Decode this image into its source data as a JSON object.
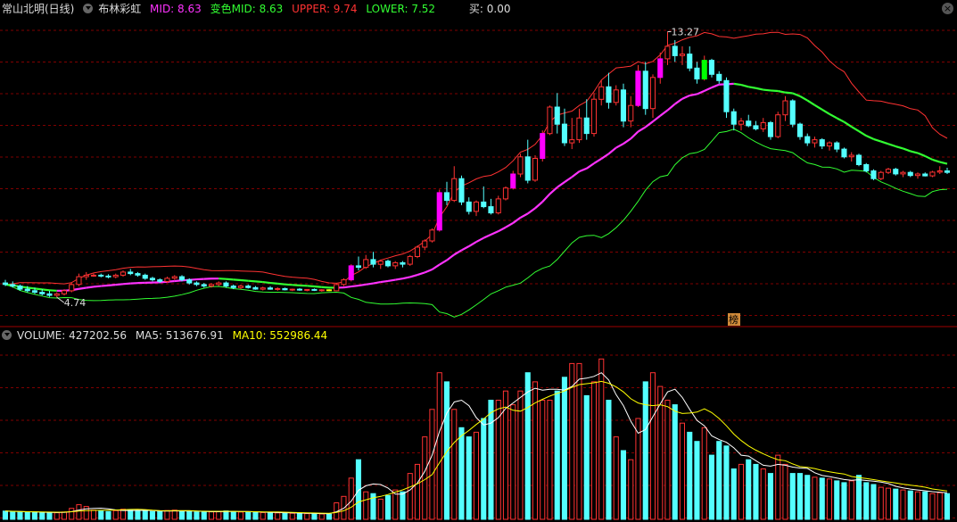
{
  "header": {
    "stock_name": "常山北明(日线)",
    "indicator_name": "布林彩虹",
    "mid": "MID: 8.63",
    "mid_color": "变色MID: 8.63",
    "upper": "UPPER: 9.74",
    "lower": "LOWER: 7.52",
    "buy": "买: 0.00"
  },
  "volume_header": {
    "volume": "VOLUME: 427202.56",
    "ma5": "MA5: 513676.91",
    "ma10": "MA10: 552986.44"
  },
  "annotations": {
    "high_label": "13.27",
    "low_label": "4.74",
    "badge": "榜"
  },
  "colors": {
    "up": "#ff3232",
    "down": "#54ffff",
    "mid_line": "#ff32ff",
    "mid_line_up": "#32ff32",
    "upper_band": "#ff3232",
    "lower_band": "#32ff32",
    "ma5": "#ffffff",
    "ma10": "#ffff00",
    "grid": "#800000",
    "highlight_magenta": "#ff00ff",
    "highlight_yellow": "#ffff00",
    "highlight_green": "#00ff00"
  },
  "chart_data": {
    "type": "candlestick",
    "price_range": [
      4.2,
      13.6
    ],
    "candles": [
      [
        5.2,
        5.3,
        5.1,
        5.15
      ],
      [
        5.15,
        5.25,
        5.05,
        5.1
      ],
      [
        5.1,
        5.15,
        4.95,
        5.0
      ],
      [
        5.0,
        5.1,
        4.9,
        4.95
      ],
      [
        4.95,
        5.05,
        4.85,
        4.9
      ],
      [
        4.9,
        5.0,
        4.8,
        4.85
      ],
      [
        4.85,
        4.95,
        4.75,
        4.8
      ],
      [
        4.8,
        4.9,
        4.74,
        4.85
      ],
      [
        4.85,
        5.0,
        4.8,
        4.95
      ],
      [
        4.95,
        5.2,
        4.9,
        5.15
      ],
      [
        5.15,
        5.5,
        5.1,
        5.4
      ],
      [
        5.4,
        5.55,
        5.3,
        5.45
      ],
      [
        5.45,
        5.5,
        5.4,
        5.45
      ],
      [
        5.45,
        5.5,
        5.38,
        5.42
      ],
      [
        5.42,
        5.48,
        5.35,
        5.4
      ],
      [
        5.4,
        5.5,
        5.35,
        5.45
      ],
      [
        5.45,
        5.6,
        5.4,
        5.55
      ],
      [
        5.55,
        5.65,
        5.45,
        5.5
      ],
      [
        5.5,
        5.55,
        5.4,
        5.45
      ],
      [
        5.45,
        5.5,
        5.3,
        5.35
      ],
      [
        5.35,
        5.4,
        5.25,
        5.3
      ],
      [
        5.3,
        5.35,
        5.2,
        5.25
      ],
      [
        5.25,
        5.4,
        5.2,
        5.35
      ],
      [
        5.35,
        5.45,
        5.3,
        5.4
      ],
      [
        5.4,
        5.45,
        5.25,
        5.3
      ],
      [
        5.3,
        5.35,
        5.15,
        5.2
      ],
      [
        5.2,
        5.25,
        5.1,
        5.15
      ],
      [
        5.15,
        5.2,
        5.05,
        5.1
      ],
      [
        5.1,
        5.2,
        5.05,
        5.15
      ],
      [
        5.15,
        5.25,
        5.1,
        5.2
      ],
      [
        5.2,
        5.25,
        5.05,
        5.1
      ],
      [
        5.1,
        5.15,
        5.0,
        5.05
      ],
      [
        5.05,
        5.15,
        5.0,
        5.1
      ],
      [
        5.1,
        5.15,
        5.02,
        5.05
      ],
      [
        5.05,
        5.1,
        4.98,
        5.0
      ],
      [
        5.0,
        5.08,
        4.96,
        5.04
      ],
      [
        5.04,
        5.1,
        4.98,
        5.0
      ],
      [
        5.0,
        5.06,
        4.95,
        5.02
      ],
      [
        5.02,
        5.05,
        4.96,
        4.98
      ],
      [
        4.98,
        5.02,
        4.94,
        5.0
      ],
      [
        5.0,
        5.04,
        4.95,
        4.97
      ],
      [
        4.97,
        5.0,
        4.93,
        4.99
      ],
      [
        4.99,
        5.02,
        4.94,
        4.96
      ],
      [
        4.96,
        5.0,
        4.92,
        4.98
      ],
      [
        4.98,
        5.0,
        4.93,
        4.95
      ],
      [
        4.95,
        5.2,
        4.93,
        5.15
      ],
      [
        5.15,
        5.35,
        5.1,
        5.3
      ],
      [
        5.3,
        5.8,
        5.25,
        5.75
      ],
      [
        5.75,
        6.05,
        5.6,
        5.7
      ],
      [
        5.7,
        6.1,
        5.65,
        5.95
      ],
      [
        5.95,
        6.2,
        5.7,
        5.8
      ],
      [
        5.8,
        5.95,
        5.65,
        5.9
      ],
      [
        5.9,
        5.95,
        5.7,
        5.75
      ],
      [
        5.75,
        5.9,
        5.65,
        5.85
      ],
      [
        5.85,
        5.9,
        5.7,
        5.8
      ],
      [
        5.8,
        6.1,
        5.75,
        6.05
      ],
      [
        6.05,
        6.4,
        6.0,
        6.35
      ],
      [
        6.35,
        6.6,
        6.25,
        6.55
      ],
      [
        6.55,
        6.95,
        6.5,
        6.9
      ],
      [
        6.9,
        8.2,
        6.85,
        8.1
      ],
      [
        8.1,
        8.45,
        7.7,
        7.85
      ],
      [
        7.85,
        8.95,
        7.8,
        8.55
      ],
      [
        8.55,
        8.65,
        7.7,
        7.8
      ],
      [
        7.8,
        7.95,
        7.4,
        7.5
      ],
      [
        7.5,
        7.85,
        7.35,
        7.8
      ],
      [
        7.8,
        8.3,
        7.6,
        7.65
      ],
      [
        7.65,
        7.9,
        7.4,
        7.45
      ],
      [
        7.45,
        8.0,
        7.4,
        7.9
      ],
      [
        7.9,
        8.3,
        7.85,
        8.25
      ],
      [
        8.25,
        8.8,
        8.2,
        8.7
      ],
      [
        8.7,
        9.35,
        8.6,
        9.25
      ],
      [
        9.25,
        9.8,
        8.4,
        8.5
      ],
      [
        8.5,
        9.3,
        8.45,
        9.2
      ],
      [
        9.2,
        10.1,
        9.1,
        10.0
      ],
      [
        10.0,
        10.9,
        9.95,
        10.85
      ],
      [
        10.85,
        11.3,
        10.0,
        10.3
      ],
      [
        10.3,
        10.8,
        9.6,
        9.7
      ],
      [
        9.7,
        10.5,
        9.5,
        9.8
      ],
      [
        9.8,
        10.8,
        9.7,
        10.5
      ],
      [
        10.5,
        11.1,
        9.8,
        10.0
      ],
      [
        10.0,
        11.3,
        9.9,
        11.1
      ],
      [
        11.1,
        11.7,
        10.9,
        11.5
      ],
      [
        11.5,
        11.95,
        10.8,
        11.0
      ],
      [
        11.0,
        11.55,
        10.9,
        11.4
      ],
      [
        11.4,
        11.6,
        10.2,
        10.4
      ],
      [
        10.4,
        11.2,
        10.2,
        10.9
      ],
      [
        10.9,
        12.2,
        10.85,
        12.0
      ],
      [
        12.0,
        12.3,
        10.6,
        10.8
      ],
      [
        10.8,
        11.9,
        10.5,
        11.8
      ],
      [
        11.8,
        12.6,
        11.6,
        12.4
      ],
      [
        12.4,
        13.27,
        12.2,
        12.8
      ],
      [
        12.8,
        13.0,
        12.3,
        12.5
      ],
      [
        12.5,
        12.8,
        12.2,
        12.55
      ],
      [
        12.55,
        12.8,
        12.0,
        12.1
      ],
      [
        12.1,
        12.3,
        11.6,
        11.75
      ],
      [
        11.75,
        12.5,
        11.7,
        12.35
      ],
      [
        12.35,
        12.4,
        11.8,
        11.9
      ],
      [
        11.9,
        12.0,
        11.6,
        11.7
      ],
      [
        11.7,
        11.8,
        10.5,
        10.7
      ],
      [
        10.7,
        10.8,
        10.1,
        10.3
      ],
      [
        10.3,
        10.5,
        10.1,
        10.4
      ],
      [
        10.4,
        10.6,
        10.2,
        10.25
      ],
      [
        10.25,
        10.4,
        10.1,
        10.15
      ],
      [
        10.15,
        10.5,
        10.05,
        10.35
      ],
      [
        10.35,
        10.4,
        9.8,
        9.9
      ],
      [
        9.9,
        10.7,
        9.85,
        10.6
      ],
      [
        10.6,
        11.2,
        10.4,
        11.05
      ],
      [
        11.05,
        11.1,
        10.2,
        10.3
      ],
      [
        10.3,
        10.35,
        9.8,
        9.9
      ],
      [
        9.9,
        10.0,
        9.6,
        9.7
      ],
      [
        9.7,
        9.9,
        9.55,
        9.8
      ],
      [
        9.8,
        9.85,
        9.5,
        9.6
      ],
      [
        9.6,
        9.75,
        9.45,
        9.7
      ],
      [
        9.7,
        9.75,
        9.4,
        9.5
      ],
      [
        9.5,
        9.55,
        9.2,
        9.25
      ],
      [
        9.25,
        9.4,
        9.1,
        9.3
      ],
      [
        9.3,
        9.35,
        8.95,
        9.0
      ],
      [
        9.0,
        9.05,
        8.75,
        8.8
      ],
      [
        8.8,
        8.85,
        8.5,
        8.55
      ],
      [
        8.55,
        8.8,
        8.5,
        8.75
      ],
      [
        8.75,
        8.9,
        8.7,
        8.85
      ],
      [
        8.85,
        8.9,
        8.65,
        8.7
      ],
      [
        8.7,
        8.8,
        8.6,
        8.75
      ],
      [
        8.75,
        8.8,
        8.6,
        8.65
      ],
      [
        8.65,
        8.75,
        8.55,
        8.7
      ],
      [
        8.7,
        8.75,
        8.62,
        8.64
      ],
      [
        8.64,
        8.8,
        8.6,
        8.76
      ],
      [
        8.76,
        8.95,
        8.7,
        8.8
      ],
      [
        8.8,
        8.9,
        8.7,
        8.75
      ]
    ],
    "volume_range": [
      0,
      1850000
    ],
    "volume": [
      90000,
      85000,
      80000,
      75000,
      80000,
      70000,
      75000,
      72000,
      80000,
      120000,
      160000,
      140000,
      100000,
      90000,
      85000,
      95000,
      110000,
      100000,
      95000,
      90000,
      85000,
      90000,
      95000,
      100000,
      90000,
      85000,
      80000,
      78000,
      82000,
      88000,
      92000,
      85000,
      80000,
      78000,
      76000,
      74000,
      72000,
      70000,
      68000,
      66000,
      64000,
      62000,
      60000,
      58000,
      56000,
      180000,
      250000,
      450000,
      650000,
      300000,
      280000,
      220000,
      260000,
      320000,
      300000,
      500000,
      600000,
      900000,
      1200000,
      1600000,
      1500000,
      1200000,
      1000000,
      900000,
      950000,
      1100000,
      1300000,
      1300000,
      1400000,
      1250000,
      1400000,
      1600000,
      1500000,
      1300000,
      1300000,
      1400000,
      1550000,
      1700000,
      1700000,
      1350000,
      1500000,
      1750000,
      1300000,
      900000,
      750000,
      650000,
      1100000,
      1500000,
      1600000,
      1450000,
      1300000,
      1250000,
      1050000,
      950000,
      850000,
      1000000,
      700000,
      850000,
      800000,
      550000,
      600000,
      650000,
      600000,
      550000,
      500000,
      700000,
      600000,
      500000,
      500000,
      480000,
      460000,
      450000,
      440000,
      420000,
      400000,
      420000,
      480000,
      400000,
      380000,
      350000,
      340000,
      330000,
      320000,
      310000,
      300000,
      300000,
      280000,
      290000,
      280000
    ],
    "highlights": [
      {
        "index": 47,
        "color": "magenta"
      },
      {
        "index": 59,
        "color": "magenta"
      },
      {
        "index": 69,
        "color": "magenta"
      },
      {
        "index": 73,
        "color": "magenta"
      },
      {
        "index": 86,
        "color": "magenta"
      },
      {
        "index": 89,
        "color": "magenta"
      },
      {
        "index": 44,
        "color": "yellow"
      },
      {
        "index": 95,
        "color": "green"
      }
    ]
  }
}
